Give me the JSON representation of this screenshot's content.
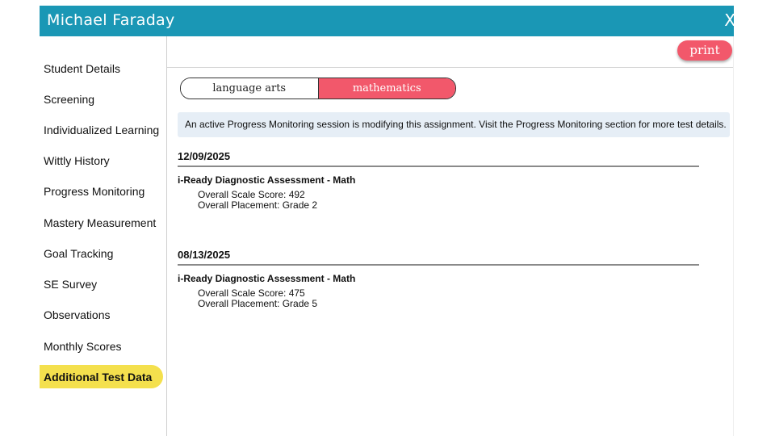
{
  "window": {
    "title": "Michael Faraday",
    "close_label": "X"
  },
  "sidebar": {
    "items": [
      {
        "label": "Student Details"
      },
      {
        "label": "Screening"
      },
      {
        "label": "Individualized Learning"
      },
      {
        "label": "Wittly History"
      },
      {
        "label": "Progress Monitoring"
      },
      {
        "label": "Mastery Measurement"
      },
      {
        "label": "Goal Tracking"
      },
      {
        "label": "SE Survey"
      },
      {
        "label": "Observations"
      },
      {
        "label": "Monthly Scores"
      },
      {
        "label": "Additional Test Data",
        "active": true
      }
    ]
  },
  "toolbar": {
    "print_label": "print"
  },
  "tabs": [
    {
      "label": "language arts",
      "active": false
    },
    {
      "label": "mathematics",
      "active": true
    }
  ],
  "notice": "An active Progress Monitoring session is modifying this assignment. Visit the Progress Monitoring section for more test details.",
  "records": [
    {
      "date": "12/09/2025",
      "assessment": "i-Ready Diagnostic Assessment - Math",
      "scale_score": "Overall Scale Score: 492",
      "placement": "Overall Placement: Grade 2"
    },
    {
      "date": "08/13/2025",
      "assessment": "i-Ready Diagnostic Assessment - Math",
      "scale_score": "Overall Scale Score: 475",
      "placement": "Overall Placement: Grade 5"
    }
  ],
  "colors": {
    "header": "#1a97b5",
    "accent": "#f2586b",
    "active_nav": "#f4e04d",
    "notice_bg": "#e6eef6"
  }
}
